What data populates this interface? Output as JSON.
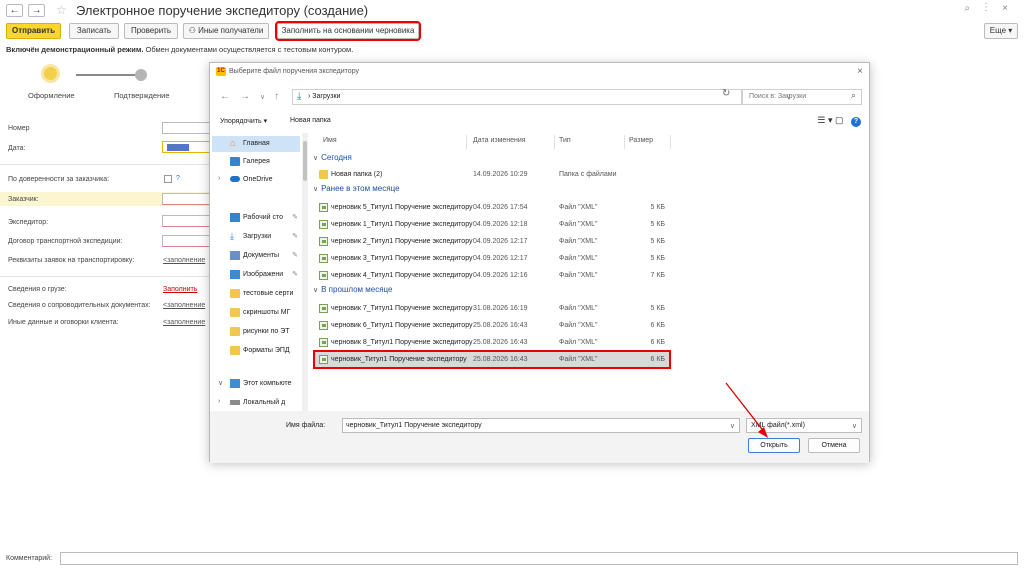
{
  "window": {
    "title": "Электронное поручение экспедитору (создание)",
    "back_icon": "←",
    "forward_icon": "→",
    "star_icon": "☆",
    "top_icons": "⌕ ⋮ ×"
  },
  "toolbar": {
    "send": "Отправить",
    "save": "Записать",
    "check": "Проверить",
    "other_recipients": "Иные получатели",
    "fill_from_draft": "Заполнить на основании черновика",
    "more": "Еще ▾"
  },
  "demo": {
    "bold": "Включён демонстрационный режим.",
    "text": " Обмен документами осуществляется с тестовым контуром."
  },
  "stepper": {
    "step1": "Оформление",
    "step2": "Подтверждение"
  },
  "form": {
    "number": "Номер",
    "date": "Дата:",
    "by_proxy": "По доверенности за заказчика:",
    "question": "?",
    "customer": "Заказчик:",
    "forwarder": "Экспедитор:",
    "contract": "Договор транспортной экспедиции:",
    "requisites": "Реквизиты заявок на транспортировку:",
    "fill_placeholder": "<заполнение",
    "cargo": "Сведения о грузе:",
    "fill_link": "Заполнить",
    "docs": "Сведения о сопроводительных документах:",
    "other": "Иные данные и оговорки клиента:",
    "comment": "Комментарий:"
  },
  "dialog": {
    "title": "Выберите файл поручения экспедитору",
    "logo": "1С",
    "close": "×",
    "address": "Загрузки",
    "search_placeholder": "Поиск в: Загрузки",
    "organize": "Упорядочить ▾",
    "new_folder": "Новая папка",
    "view_icons": "☰ ▾  ▢",
    "help": "?",
    "nav": [
      {
        "label": "Главная",
        "kind": "home"
      },
      {
        "label": "Галерея",
        "kind": "gallery"
      },
      {
        "label": "OneDrive",
        "kind": "cloud"
      },
      {
        "label": "Рабочий сто",
        "kind": "desktop"
      },
      {
        "label": "Загрузки",
        "kind": "download"
      },
      {
        "label": "Документы",
        "kind": "docs"
      },
      {
        "label": "Изображени",
        "kind": "pics"
      },
      {
        "label": "тестовые серти",
        "kind": "folder"
      },
      {
        "label": "скриншоты МГ",
        "kind": "folder"
      },
      {
        "label": "рисунки по ЭТ",
        "kind": "folder"
      },
      {
        "label": "Форматы ЭПД",
        "kind": "folder"
      },
      {
        "label": "Этот компьюте",
        "kind": "pc"
      },
      {
        "label": "Локальный д",
        "kind": "drive"
      }
    ],
    "columns": {
      "name": "Имя",
      "date": "Дата изменения",
      "type": "Тип",
      "size": "Размер"
    },
    "groups": {
      "today": "Сегодня",
      "earlier_month": "Ранее в этом месяце",
      "last_month": "В прошлом месяце"
    },
    "files_today": [
      {
        "name": "Новая папка (2)",
        "date": "14.09.2026 10:29",
        "type": "Папка с файлами",
        "size": ""
      }
    ],
    "files_earlier": [
      {
        "name": "черновик 5_Титул1 Поручение экспедитору",
        "date": "04.09.2026 17:54",
        "type": "Файл \"XML\"",
        "size": "5 КБ"
      },
      {
        "name": "черновик 1_Титул1 Поручение экспедитору",
        "date": "04.09.2026 12:18",
        "type": "Файл \"XML\"",
        "size": "5 КБ"
      },
      {
        "name": "черновик 2_Титул1 Поручение экспедитору",
        "date": "04.09.2026 12:17",
        "type": "Файл \"XML\"",
        "size": "5 КБ"
      },
      {
        "name": "черновик 3_Титул1 Поручение экспедитору",
        "date": "04.09.2026 12:17",
        "type": "Файл \"XML\"",
        "size": "5 КБ"
      },
      {
        "name": "черновик 4_Титул1 Поручение экспедитору",
        "date": "04.09.2026 12:16",
        "type": "Файл \"XML\"",
        "size": "7 КБ"
      }
    ],
    "files_last_month": [
      {
        "name": "черновик 7_Титул1 Поручение экспедитору",
        "date": "31.08.2026 16:19",
        "type": "Файл \"XML\"",
        "size": "5 КБ"
      },
      {
        "name": "черновик 6_Титул1 Поручение экспедитору",
        "date": "25.08.2026 16:43",
        "type": "Файл \"XML\"",
        "size": "6 КБ"
      },
      {
        "name": "черновик 8_Титул1 Поручение экспедитору",
        "date": "25.08.2026 16:43",
        "type": "Файл \"XML\"",
        "size": "6 КБ"
      },
      {
        "name": "черновик_Титул1 Поручение экспедитору",
        "date": "25.08.2026 16:43",
        "type": "Файл \"XML\"",
        "size": "6 КБ"
      }
    ],
    "filename_label": "Имя файла:",
    "filename_value": "черновик_Титул1 Поручение экспедитору",
    "filetype": "XML файл(*.xml)",
    "open": "Открыть",
    "cancel": "Отмена"
  },
  "colors": {
    "primary_button": "#fcd530",
    "highlight": "#e00000",
    "link": "#1a4f9c"
  }
}
